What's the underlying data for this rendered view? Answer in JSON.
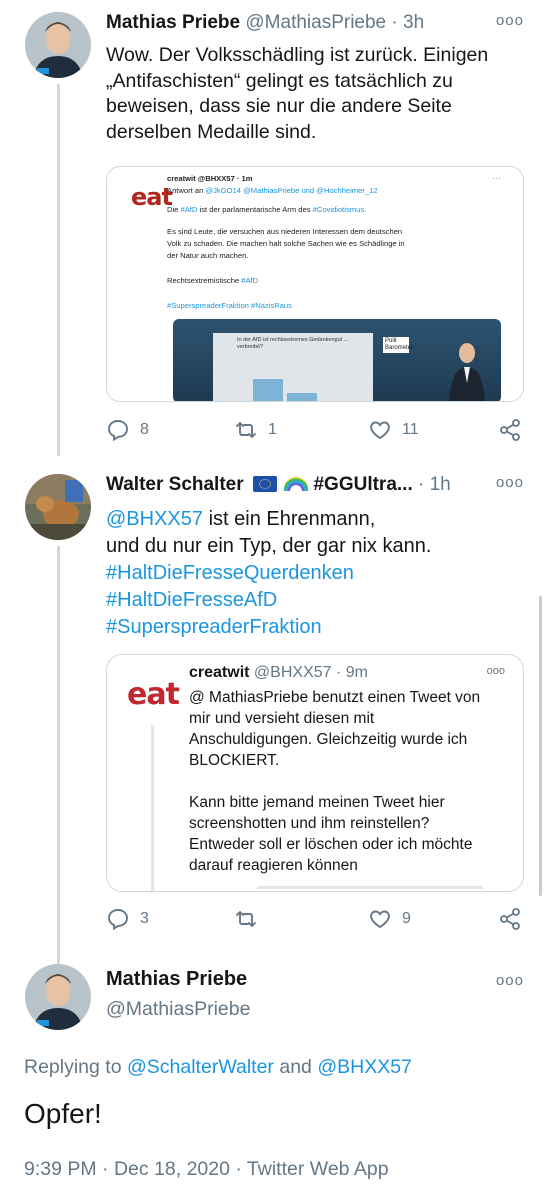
{
  "tweet1": {
    "name": "Mathias Priebe",
    "handle": "@MathiasPriebe",
    "separator": "·",
    "time": "3h",
    "text_lines": [
      "Wow. Der Volksschädling ist zurück. Einigen",
      "„Antifaschisten“ gelingt es tatsächlich zu",
      "beweisen, dass sie nur die andere Seite",
      "derselben Medaille sind."
    ],
    "embedded_screenshot": {
      "logo": "eat",
      "header": "creatwit @BHXX57 · 1m",
      "reply_prefix": "Antwort an ",
      "reply_handles": "@JkGO14 @MathiasPriebe und @Hochheimer_12",
      "line1_prefix": "Die ",
      "line1_tag1": "#AfD",
      "line1_mid": " ist der parlamentarische Arm des ",
      "line1_tag2": "#Covidiotismus.",
      "line2": "Es sind Leute, die versuchen aus niederen Interessen dem deutschen",
      "line3": "Volk zu schaden. Die machen halt solche Sachen wie es Schädlinge in",
      "line4": "der Natur auch machen.",
      "line5_prefix": "Rechtsextremistische ",
      "line5_tag": "#AfD",
      "line6": "#SuperspreaderFraktion #NazisRaus",
      "video_text": "In der AfD ist rechtsextremes Gedankengut ... verbreitet?",
      "video_logo": "Polit Barometer"
    },
    "replies": "8",
    "retweets": "1",
    "likes": "11"
  },
  "tweet2": {
    "name": "Walter Schalter",
    "name_suffix": "#GGUltra...",
    "separator": "·",
    "time": "1h",
    "mention": "@BHXX57",
    "line1_rest": " ist ein Ehrenmann,",
    "line2": "und du nur ein Typ, der gar nix kann.",
    "hashtags": [
      "#HaltDieFresseQuerdenken",
      "#HaltDieFresseAfD",
      "#SuperspreaderFraktion"
    ],
    "quote": {
      "logo": "eat",
      "name": "creatwit",
      "handle": "@BHXX57",
      "separator": "·",
      "time": "9m",
      "text_lines": [
        "@ MathiasPriebe benutzt einen Tweet von",
        "mir und versieht diesen mit",
        "Anschuldigungen. Gleichzeitig wurde ich",
        "BLOCKIERT.",
        "",
        "Kann bitte jemand meinen Tweet hier",
        "screenshotten und ihm reinstellen?",
        "Entweder soll er löschen oder ich möchte",
        "darauf reagieren können"
      ]
    },
    "replies": "3",
    "retweets": "",
    "likes": "9"
  },
  "main_tweet": {
    "name": "Mathias Priebe",
    "handle": "@MathiasPriebe",
    "replying_prefix": "Replying to ",
    "replying_user1": "@SchalterWalter",
    "replying_and": " and ",
    "replying_user2": "@BHXX57",
    "text": "Opfer!",
    "meta": "9:39 PM · Dec 18, 2020 · Twitter Web App"
  },
  "more_glyph": "ooo",
  "colors": {
    "link": "#1b95e0",
    "muted": "#657786",
    "text": "#14171a",
    "logo_red": "#c0282d"
  }
}
